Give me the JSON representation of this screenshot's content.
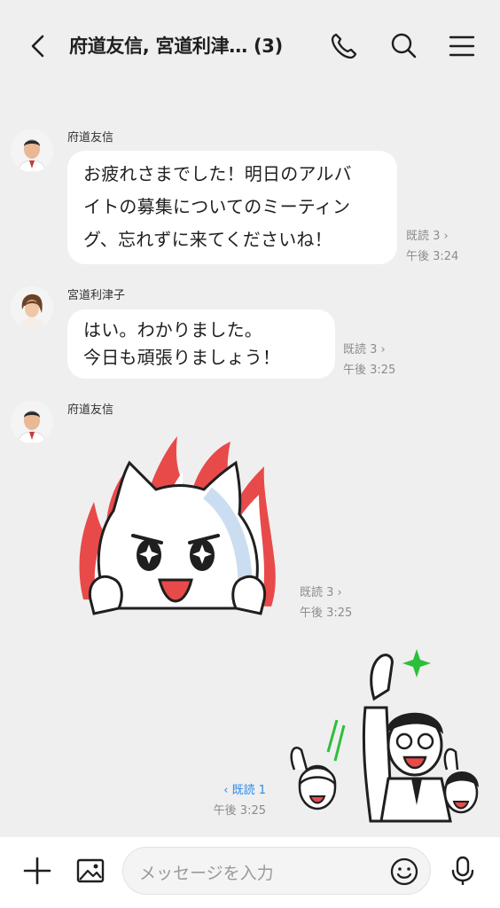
{
  "header": {
    "title": "府道友信, 宮道利津… (3)",
    "back_icon": "chevron-left-icon",
    "call_icon": "phone-icon",
    "search_icon": "search-icon",
    "menu_icon": "hamburger-menu-icon"
  },
  "messages": [
    {
      "sender": "府道友信",
      "lines": [
        "お疲れさまでした！明日のアルバ",
        "イトの募集についてのミーティン",
        "グ、忘れずに来てくださいね！"
      ],
      "read": "既読 3 ›",
      "time": "午後 3:24"
    },
    {
      "sender": "宮道利津子",
      "lines": [
        "はい。わかりました。",
        "今日も頑張りましょう！"
      ],
      "read": "既読 3 ›",
      "time": "午後 3:25"
    },
    {
      "sender": "府道友信",
      "sticker": "fire-cat-sticker",
      "read": "既読 3 ›",
      "time": "午後 3:25"
    },
    {
      "sender": "",
      "sticker": "cheering-people-sticker",
      "read": "‹ 既読 1",
      "time": "午後 3:25"
    }
  ],
  "input": {
    "placeholder": "メッセージを入力",
    "plus_icon": "plus-icon",
    "image_icon": "image-icon",
    "emoji_icon": "smiley-icon",
    "mic_icon": "microphone-icon"
  },
  "colors": {
    "background": "#efefef",
    "bubble": "#ffffff",
    "read_blue": "#2f8be8",
    "meta_gray": "#8c8c8c"
  }
}
